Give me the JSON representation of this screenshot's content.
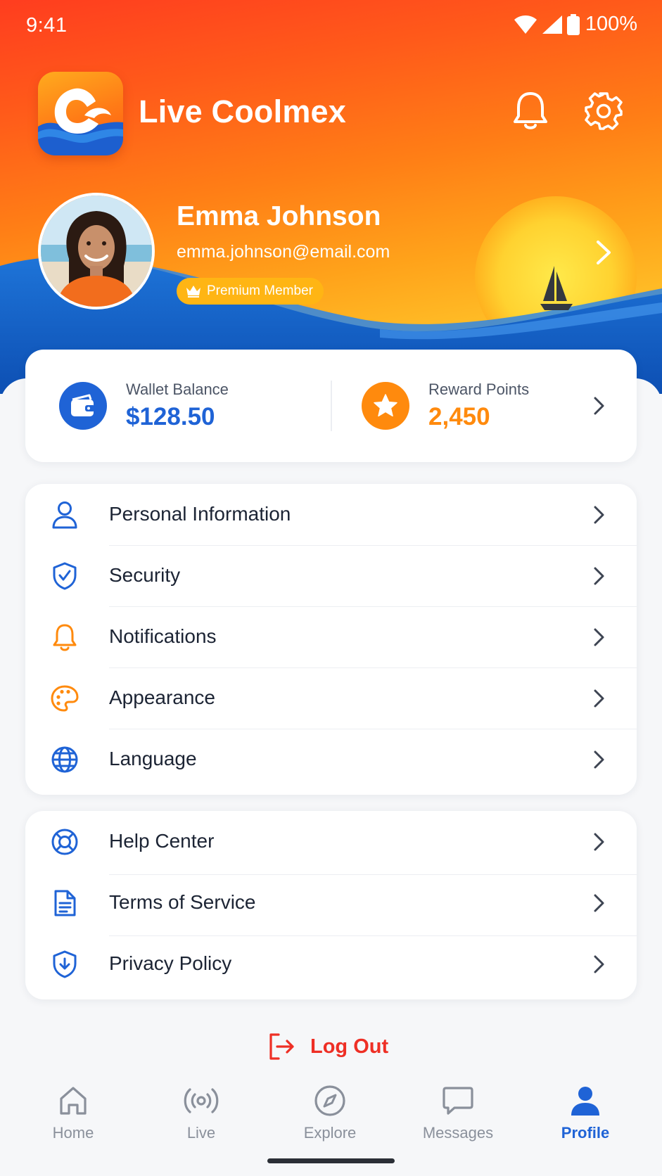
{
  "status_bar": {
    "time": "9:41",
    "battery": "100%"
  },
  "header": {
    "app_title": "Live Coolmex"
  },
  "profile": {
    "name": "Emma Johnson",
    "email": "emma.johnson@email.com",
    "badge": "Premium Member"
  },
  "wallet": {
    "balance_label": "Wallet Balance",
    "balance_value": "$128.50",
    "points_label": "Reward Points",
    "points_value": "2,450"
  },
  "account_menu": [
    {
      "label": "Personal Information",
      "icon": "user-icon"
    },
    {
      "label": "Security",
      "icon": "shield-check-icon"
    },
    {
      "label": "Notifications",
      "icon": "bell-icon"
    },
    {
      "label": "Appearance",
      "icon": "palette-icon"
    },
    {
      "label": "Language",
      "icon": "globe-icon"
    }
  ],
  "support_menu": [
    {
      "label": "Help Center",
      "icon": "lifebuoy-icon"
    },
    {
      "label": "Terms of Service",
      "icon": "document-icon"
    },
    {
      "label": "Privacy Policy",
      "icon": "shield-icon"
    }
  ],
  "logout_label": "Log Out",
  "bottom_nav": [
    {
      "label": "Home",
      "icon": "home-icon"
    },
    {
      "label": "Live",
      "icon": "broadcast-icon"
    },
    {
      "label": "Explore",
      "icon": "compass-icon"
    },
    {
      "label": "Messages",
      "icon": "chat-icon"
    },
    {
      "label": "Profile",
      "icon": "person-icon",
      "active": true
    }
  ],
  "colors": {
    "primary_blue": "#1f63d6",
    "accent_orange": "#ff8a0d",
    "logout_red": "#ee2f25",
    "badge_gold": "#ffb514"
  }
}
